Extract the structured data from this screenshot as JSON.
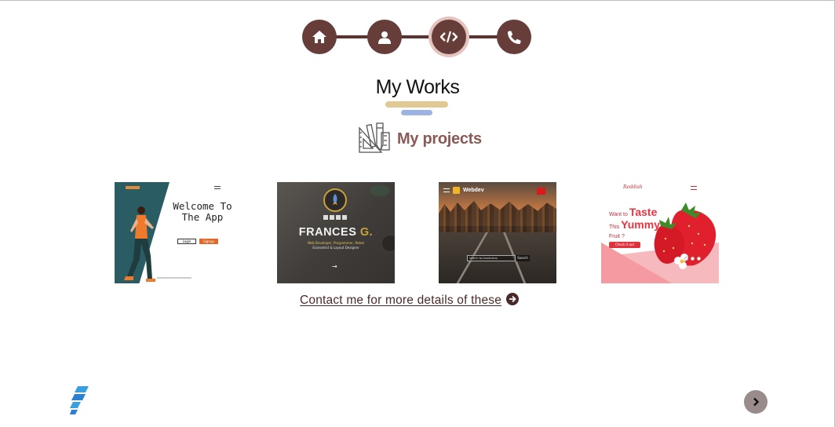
{
  "nav": {
    "steps": [
      {
        "icon": "home-icon",
        "label": "Home"
      },
      {
        "icon": "user-icon",
        "label": "About"
      },
      {
        "icon": "code-icon",
        "label": "Works",
        "active": true
      },
      {
        "icon": "phone-icon",
        "label": "Contact"
      }
    ],
    "colors": {
      "step": "#673d39",
      "active_ring": "#e5c4c0"
    }
  },
  "section": {
    "title": "My Works",
    "subtitle": "My projects",
    "subtitle_icon": "drafting-tools-icon",
    "underline_colors": [
      "#e2c892",
      "#9db3e3"
    ]
  },
  "projects": [
    {
      "name": "welcome-app",
      "heading": "Welcome To The App",
      "login": "Login",
      "signup": "Signup"
    },
    {
      "name": "portfolio",
      "heading_main": "FRANCES ",
      "heading_accent": "G.",
      "line1": "Web Developer, Programmer, Robot",
      "line2": "Economist & Layout Designer"
    },
    {
      "name": "webdev",
      "brand": "Webdev",
      "search_placeholder": "search by bootcamp",
      "search_button": "Search"
    },
    {
      "name": "strawberry",
      "logo": "Reddish",
      "line1": "Want to",
      "word1": "Taste",
      "line2": "This",
      "word2": "Yummy",
      "line3": "Fruit ?",
      "cta": "Check it out"
    }
  ],
  "contact": {
    "text": "Contact me for more details of these",
    "icon": "arrow-circle-right-icon"
  },
  "footer": {
    "brand_icon": "stacked-logo-icon",
    "next_icon": "chevron-right-icon",
    "next_color": "#9a8c8c"
  }
}
